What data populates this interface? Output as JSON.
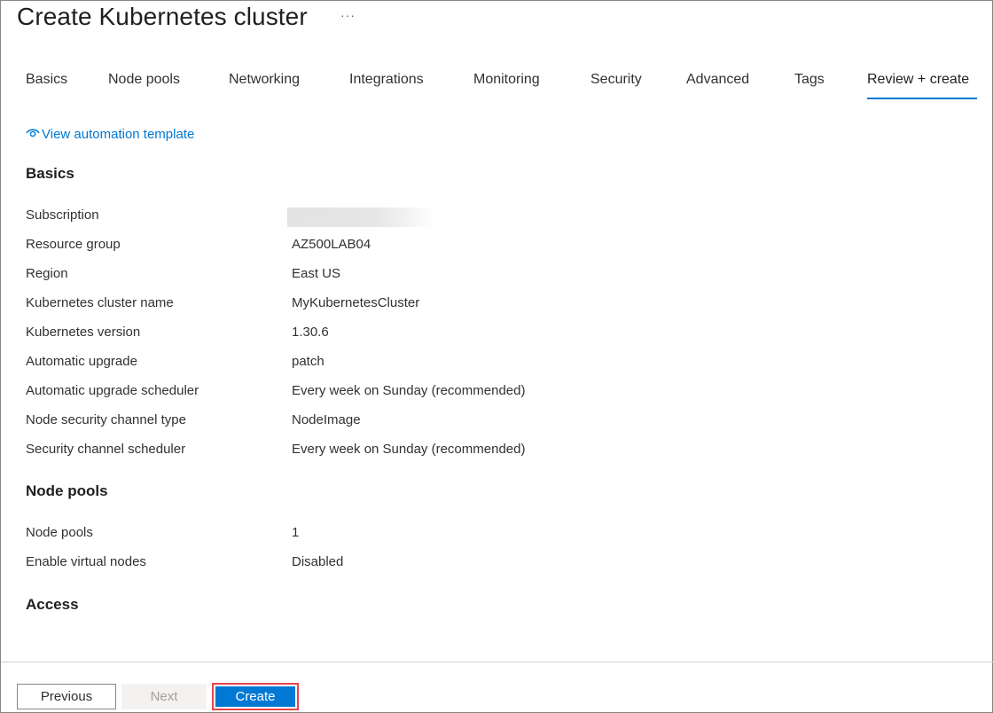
{
  "header": {
    "title": "Create Kubernetes cluster",
    "more_label": "···"
  },
  "tabs": [
    {
      "label": "Basics"
    },
    {
      "label": "Node pools"
    },
    {
      "label": "Networking"
    },
    {
      "label": "Integrations"
    },
    {
      "label": "Monitoring"
    },
    {
      "label": "Security"
    },
    {
      "label": "Advanced"
    },
    {
      "label": "Tags"
    },
    {
      "label": "Review + create",
      "active": true
    }
  ],
  "automation_link": {
    "label": "View automation template",
    "icon": "eye-icon"
  },
  "sections": {
    "basics": {
      "title": "Basics",
      "rows": [
        {
          "label": "Subscription",
          "value": ""
        },
        {
          "label": "Resource group",
          "value": "AZ500LAB04"
        },
        {
          "label": "Region",
          "value": "East US"
        },
        {
          "label": "Kubernetes cluster name",
          "value": "MyKubernetesCluster"
        },
        {
          "label": "Kubernetes version",
          "value": "1.30.6"
        },
        {
          "label": "Automatic upgrade",
          "value": "patch"
        },
        {
          "label": "Automatic upgrade scheduler",
          "value": "Every week on Sunday (recommended)"
        },
        {
          "label": "Node security channel type",
          "value": "NodeImage"
        },
        {
          "label": "Security channel scheduler",
          "value": "Every week on Sunday (recommended)"
        }
      ]
    },
    "node_pools": {
      "title": "Node pools",
      "rows": [
        {
          "label": "Node pools",
          "value": "1"
        },
        {
          "label": "Enable virtual nodes",
          "value": "Disabled"
        }
      ]
    },
    "access": {
      "title": "Access"
    }
  },
  "footer": {
    "previous_label": "Previous",
    "next_label": "Next",
    "create_label": "Create"
  },
  "colors": {
    "accent": "#0078d4",
    "highlight_border": "#e8434a"
  }
}
